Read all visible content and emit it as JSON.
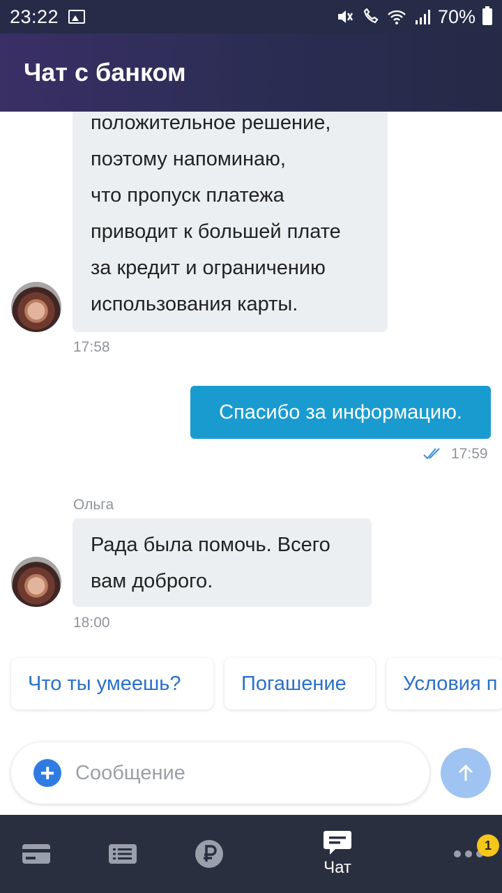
{
  "status_bar": {
    "time": "23:22",
    "battery": "70%"
  },
  "header": {
    "title": "Чат с банком"
  },
  "messages": {
    "m1": {
      "lines": [
        "положительное решение,",
        "поэтому напоминаю,",
        "что пропуск платежа",
        "приводит к большей плате",
        "за кредит и ограничению",
        "использования карты."
      ],
      "time": "17:58"
    },
    "m2": {
      "text": "Спасибо за информацию.",
      "time": "17:59",
      "status": "read"
    },
    "m3": {
      "sender": "Ольга",
      "lines": [
        "Рада была помочь. Всего",
        "вам доброго."
      ],
      "time": "18:00"
    }
  },
  "quick_replies": [
    "Что ты умеешь?",
    "Погашение",
    "Условия п"
  ],
  "composer": {
    "placeholder": "Сообщение"
  },
  "nav": {
    "items": [
      {
        "icon": "card-icon"
      },
      {
        "icon": "list-icon"
      },
      {
        "icon": "ruble-icon"
      },
      {
        "icon": "chat-icon",
        "label": "Чат",
        "active": true
      },
      {
        "icon": "more-icon",
        "badge": "1"
      }
    ]
  },
  "colors": {
    "header_bg": "#2a2d52",
    "status_bar_bg": "#262b48",
    "outgoing_bubble": "#1a9bd0",
    "incoming_bubble": "#eceff1",
    "chip_text": "#2b70c9",
    "send_button": "#9fc4f2",
    "nav_bg": "#2a2f40",
    "badge": "#f5c71a"
  }
}
